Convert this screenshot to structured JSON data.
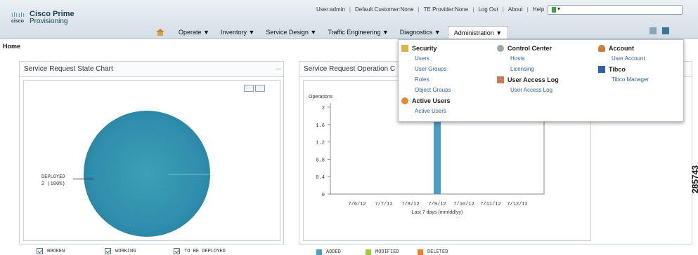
{
  "app": {
    "brand_title": "Cisco Prime",
    "brand_subtitle": "Provisioning",
    "logo_wordmark": "cisco",
    "logo_bars": "ılıılı"
  },
  "util_bar": {
    "user": "User:admin",
    "customer": "Default Customer:None",
    "provider": "TE Provider:None",
    "logout": "Log Out",
    "about": "About",
    "help": "Help",
    "separator": "|",
    "flag_caret": "▾"
  },
  "nav": {
    "items": [
      {
        "label": "Operate ▼"
      },
      {
        "label": "Inventory ▼"
      },
      {
        "label": "Service Design ▼"
      },
      {
        "label": "Traffic Engineering ▼"
      },
      {
        "label": "Diagnostics ▼"
      },
      {
        "label": "Administration ▼"
      }
    ]
  },
  "breadcrumb": "Home",
  "panel1": {
    "title": "Service Request State Chart",
    "minimize": "—",
    "deployed_label": "DEPLOYED",
    "deployed_value": "2 (100%)",
    "legend": [
      "BROKEN",
      "WORKING",
      "TO BE DEPLOYED"
    ]
  },
  "panel2": {
    "title": "Service Request Operation C",
    "ytitle": "Operations",
    "xlabel": "Last 7 days (mm/dd/yy)",
    "legend": [
      {
        "label": "ADDED",
        "color": "#4a9ec2"
      },
      {
        "label": "MODIFIED",
        "color": "#9ccc3c"
      },
      {
        "label": "DELETED",
        "color": "#ee7c2a"
      }
    ]
  },
  "chart_data": {
    "type": "bar",
    "categories": [
      "7/6/12",
      "7/7/12",
      "7/8/12",
      "7/9/12",
      "7/10/12",
      "7/11/12",
      "7/12/12"
    ],
    "series": [
      {
        "name": "ADDED",
        "values": [
          0,
          0,
          0,
          2,
          0,
          0,
          0
        ]
      }
    ],
    "ylabel": "Operations",
    "xlabel": "Last 7 days (mm/dd/yy)",
    "yticks": [
      "0",
      "0.4",
      "0.8",
      "1.2",
      "1.6",
      "2"
    ],
    "ylim": [
      0,
      2
    ],
    "grid": false
  },
  "menu": {
    "security": {
      "heading": "Security",
      "items": [
        "Users",
        "User Groups",
        "Roles",
        "Object Groups"
      ]
    },
    "active_users": {
      "heading": "Active Users",
      "items": [
        "Active Users"
      ]
    },
    "control_center": {
      "heading": "Control Center",
      "items": [
        "Hosts",
        "Licensing"
      ]
    },
    "access_log": {
      "heading": "User Access Log",
      "items": [
        "User Access Log"
      ]
    },
    "account": {
      "heading": "Account",
      "items": [
        "User Account"
      ]
    },
    "tibco": {
      "heading": "Tibco",
      "items": [
        "Tibco Manager"
      ]
    }
  },
  "figure_id": "285743"
}
